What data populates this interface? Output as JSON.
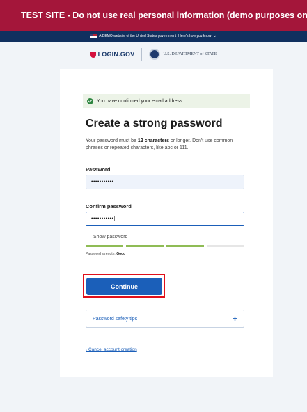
{
  "test_banner": {
    "text": "TEST SITE - Do not use real personal information (demo purposes only) - TEST SITE - Do not use real personal information"
  },
  "gov_banner": {
    "text": "A DEMO website of the United States government",
    "link": "Here's how you know",
    "chevron": "chevron-down-icon"
  },
  "brand": {
    "logo_text": "LOGIN.GOV",
    "partner": "U.S. DEPARTMENT of STATE"
  },
  "alert": {
    "text": "You have confirmed your email address",
    "icon": "check-circle-icon"
  },
  "form": {
    "title": "Create a strong password",
    "desc_prefix": "Your password must be ",
    "desc_bold": "12 characters",
    "desc_suffix": " or longer. Don't use common phrases or repeated characters, like abc or 111.",
    "password_label": "Password",
    "password_value": "•••••••••••",
    "confirm_label": "Confirm password",
    "confirm_value": "•••••••••••|",
    "show_password_label": "Show password",
    "strength_prefix": "Password strength: ",
    "strength_value": "Good",
    "strength_segments_filled": 3,
    "strength_segments_total": 4,
    "continue_label": "Continue",
    "tips_label": "Password safety tips",
    "tips_icon": "plus-icon",
    "cancel_label": "‹ Cancel account creation"
  },
  "colors": {
    "primary": "#1b5fb9",
    "test_banner": "#a4163a",
    "highlight": "#e0101b",
    "strength_on": "#8fbc55"
  }
}
